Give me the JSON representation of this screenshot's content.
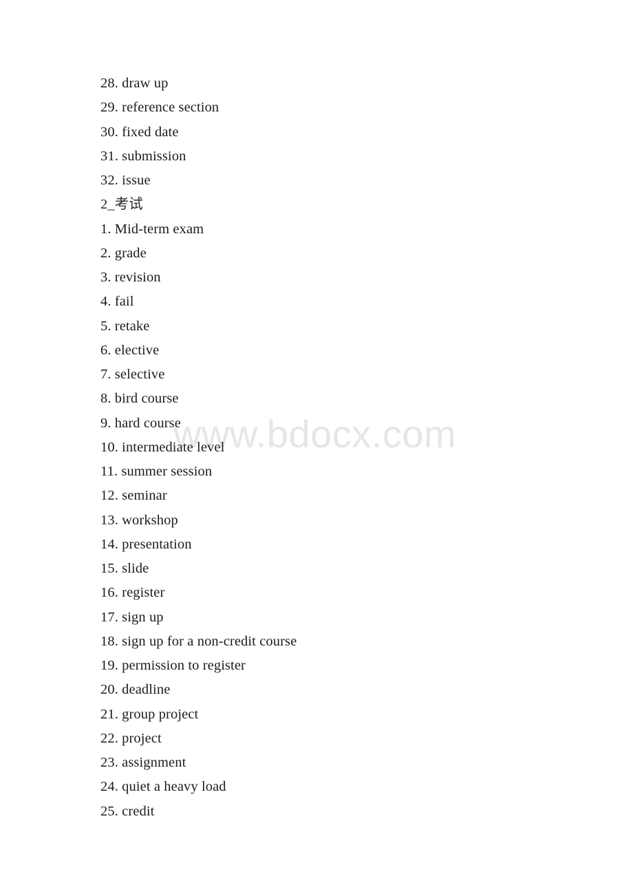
{
  "document": {
    "watermark": "www.bdocx.com",
    "watermark_color": "#e6e6e6",
    "background_color": "#ffffff",
    "text_color": "#1c1c1c"
  },
  "lines": [
    {
      "text": "28. draw up",
      "type": "list-item"
    },
    {
      "text": "29. reference section",
      "type": "list-item"
    },
    {
      "text": "30. fixed date",
      "type": "list-item"
    },
    {
      "text": "31. submission",
      "type": "list-item"
    },
    {
      "text": "32. issue",
      "type": "list-item"
    },
    {
      "text": "2_考试",
      "type": "heading"
    },
    {
      "text": "1. Mid-term exam",
      "type": "list-item"
    },
    {
      "text": "2. grade",
      "type": "list-item"
    },
    {
      "text": "3. revision",
      "type": "list-item"
    },
    {
      "text": "4. fail",
      "type": "list-item"
    },
    {
      "text": "5. retake",
      "type": "list-item"
    },
    {
      "text": "6. elective",
      "type": "list-item"
    },
    {
      "text": "7. selective",
      "type": "list-item"
    },
    {
      "text": "8. bird course",
      "type": "list-item"
    },
    {
      "text": "9. hard course",
      "type": "list-item"
    },
    {
      "text": "10. intermediate level",
      "type": "list-item"
    },
    {
      "text": "11. summer session",
      "type": "list-item"
    },
    {
      "text": "12. seminar",
      "type": "list-item"
    },
    {
      "text": "13. workshop",
      "type": "list-item"
    },
    {
      "text": "14. presentation",
      "type": "list-item"
    },
    {
      "text": "15. slide",
      "type": "list-item"
    },
    {
      "text": "16. register",
      "type": "list-item"
    },
    {
      "text": "17. sign up",
      "type": "list-item"
    },
    {
      "text": "18. sign up for a non-credit course",
      "type": "list-item"
    },
    {
      "text": "19. permission to register",
      "type": "list-item"
    },
    {
      "text": "20. deadline",
      "type": "list-item"
    },
    {
      "text": "21. group project",
      "type": "list-item"
    },
    {
      "text": "22. project",
      "type": "list-item"
    },
    {
      "text": "23. assignment",
      "type": "list-item"
    },
    {
      "text": "24. quiet a heavy load",
      "type": "list-item"
    },
    {
      "text": "25. credit",
      "type": "list-item"
    }
  ]
}
